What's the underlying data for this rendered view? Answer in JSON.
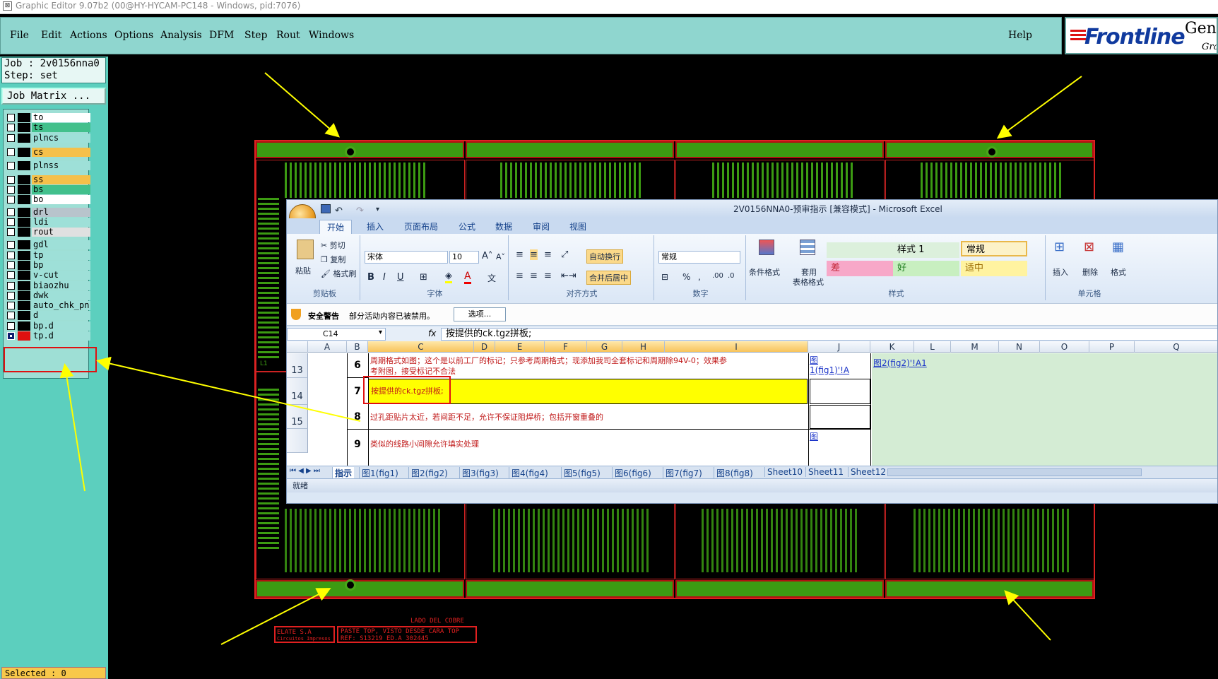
{
  "window": {
    "title": "Graphic Editor 9.07b2 (00@HY-HYCAM-PC148 - Windows, pid:7076)"
  },
  "menubar": {
    "items": [
      "File",
      "Edit",
      "Actions",
      "Options",
      "Analysis",
      "DFM",
      "Step",
      "Rout",
      "Windows"
    ],
    "help": "Help"
  },
  "logo": {
    "brand": "Frontline",
    "product": "Gene",
    "sub": "Grap"
  },
  "job": {
    "job_line": "Job : 2v0156nna0",
    "step_line": "Step: set",
    "matrix_button": "Job Matrix ..."
  },
  "layers": [
    {
      "name": "to",
      "color": "#ffffff",
      "state": "off"
    },
    {
      "name": "ts",
      "color": "#42c08c",
      "state": "off"
    },
    {
      "name": "plncs",
      "color": "#9ee0d8",
      "state": "off"
    },
    {
      "name": "cs",
      "color": "#f5c04a",
      "state": "off"
    },
    {
      "name": "plnss",
      "color": "#9ee0d8",
      "state": "off"
    },
    {
      "name": "ss",
      "color": "#f5c04a",
      "state": "off"
    },
    {
      "name": "bs",
      "color": "#42c08c",
      "state": "off"
    },
    {
      "name": "bo",
      "color": "#ffffff",
      "state": "off"
    },
    {
      "name": "drl",
      "color": "#b8c4cc",
      "state": "off"
    },
    {
      "name": "ldi",
      "color": "#9ee0d8",
      "state": "off"
    },
    {
      "name": "rout",
      "color": "#e0e0e0",
      "state": "off"
    },
    {
      "name": "gdl",
      "color": "#9ee0d8",
      "state": "off"
    },
    {
      "name": "tp",
      "color": "#9ee0d8",
      "state": "off"
    },
    {
      "name": "bp",
      "color": "#9ee0d8",
      "state": "off"
    },
    {
      "name": "v-cut",
      "color": "#9ee0d8",
      "state": "off"
    },
    {
      "name": "biaozhu",
      "color": "#9ee0d8",
      "state": "off"
    },
    {
      "name": "dwk",
      "color": "#9ee0d8",
      "state": "off"
    },
    {
      "name": "auto_chk_pn",
      "color": "#9ee0d8",
      "state": "off"
    },
    {
      "name": "d",
      "color": "#9ee0d8",
      "state": "off"
    },
    {
      "name": "bp.d",
      "color": "#9ee0d8",
      "state": "off"
    },
    {
      "name": "tp.d",
      "color": "#9ee0d8",
      "state": "active"
    }
  ],
  "selected": "Selected : 0",
  "pcb": {
    "stamp_title": "LADO DEL COBRE",
    "stamp_brand": "ELATE S.A",
    "stamp_brand_sub": "Circuitos Impresos",
    "stamp_line1": "PASTE TOP, VISTO DESDE CARA TOP",
    "stamp_line2": "REF: S13219 ED.A 302445",
    "corner_label": "L1"
  },
  "excel": {
    "title": "2V0156NNA0-预审指示 [兼容模式] - Microsoft Excel",
    "tabs": [
      "开始",
      "插入",
      "页面布局",
      "公式",
      "数据",
      "审阅",
      "视图"
    ],
    "clipboard": {
      "paste": "粘贴",
      "cut": "剪切",
      "copy": "复制",
      "format_painter": "格式刷",
      "label": "剪贴板"
    },
    "font": {
      "name": "宋体",
      "size": "10",
      "label": "字体"
    },
    "alignment": {
      "wrap": "自动换行",
      "merge": "合并后居中",
      "label": "对齐方式"
    },
    "number": {
      "format": "常规",
      "label": "数字"
    },
    "styles": {
      "conditional": "条件格式",
      "table_a": "套用",
      "table_b": "表格格式",
      "style1": "样式 1",
      "normal": "常规",
      "bad": "差",
      "good": "好",
      "neutral": "适中",
      "label": "样式"
    },
    "cells_group": {
      "insert": "插入",
      "delete": "删除",
      "format": "格式",
      "label": "单元格"
    },
    "security": {
      "title": "安全警告",
      "message": "部分活动内容已被禁用。",
      "options": "选项..."
    },
    "formula": {
      "cell_ref": "C14",
      "fx": "fx",
      "content": "按提供的ck.tgz拼板;"
    },
    "columns": [
      "A",
      "B",
      "C",
      "D",
      "E",
      "F",
      "G",
      "H",
      "I",
      "J",
      "K",
      "L",
      "M",
      "N",
      "O",
      "P",
      "Q"
    ],
    "rows": [
      {
        "num": "13",
        "idx": "6",
        "text": "周期格式如图；这个是以前工厂的标记；只参考周期格式；现添加我司全套标记和周期除94V-0；效果参",
        "text2": "考附图，接受标记不合法",
        "link": "图",
        "link2": "1(fig1)'!A",
        "link_k": "图2(fig2)'!A1"
      },
      {
        "num": "14",
        "idx": "7",
        "text": "按提供的ck.tgz拼板;"
      },
      {
        "num": "15",
        "idx": "8",
        "text": "过孔距贴片太近，若间距不足，允许不保证阻焊桥；包括开窗重叠的"
      },
      {
        "num": "",
        "idx": "9",
        "text": "类似的线路小间隙允许填实处理",
        "link": "图"
      }
    ],
    "sheets": [
      "指示",
      "图1(fig1)",
      "图2(fig2)",
      "图3(fig3)",
      "图4(fig4)",
      "图5(fig5)",
      "图6(fig6)",
      "图7(fig7)",
      "图8(fig8)",
      "Sheet10",
      "Sheet11",
      "Sheet12"
    ],
    "status": "就绪"
  }
}
